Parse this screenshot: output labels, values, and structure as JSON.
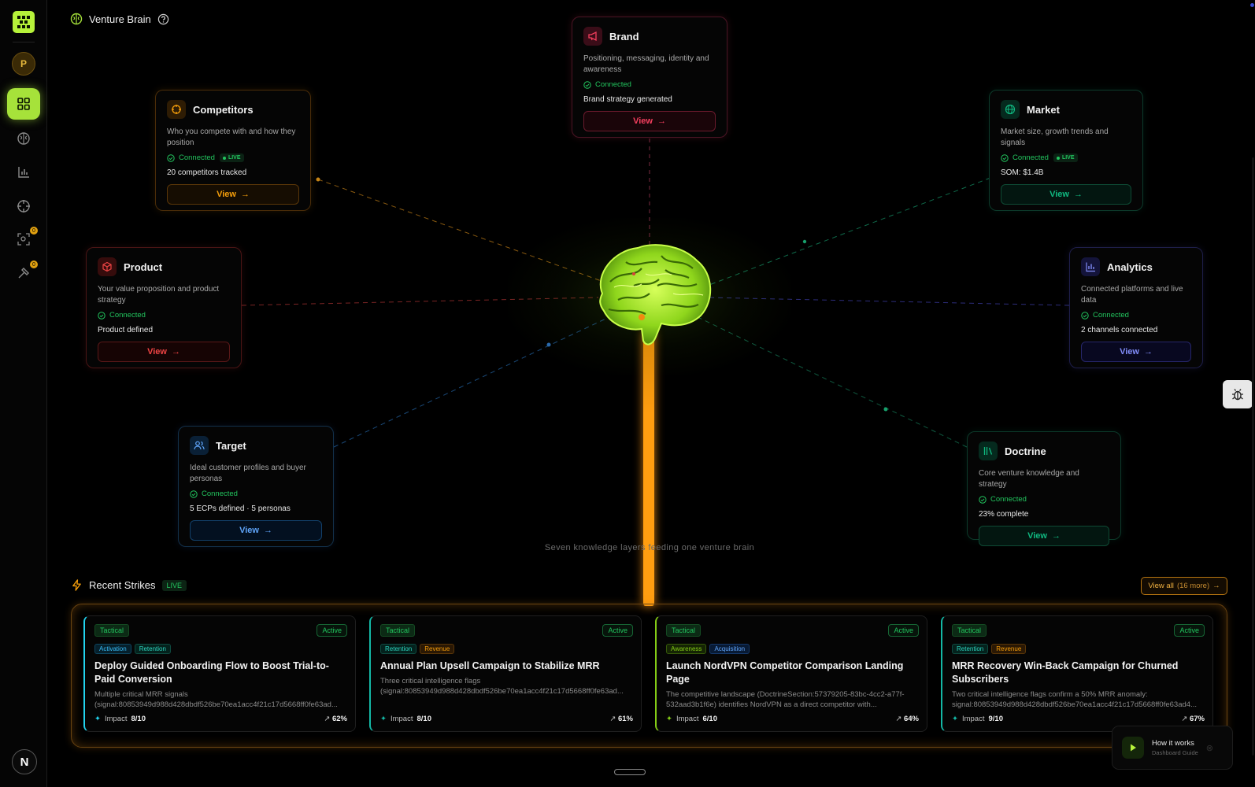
{
  "header": {
    "title": "Venture Brain"
  },
  "sidebar": {
    "avatar_initial": "P",
    "user_initial": "N",
    "badge_1": "0",
    "badge_2": "0"
  },
  "cards": {
    "brand": {
      "title": "Brand",
      "desc": "Positioning, messaging, identity and awareness",
      "status": "Connected",
      "metric": "Brand strategy generated",
      "view": "View"
    },
    "competitors": {
      "title": "Competitors",
      "desc": "Who you compete with and how they position",
      "status": "Connected",
      "live": "LIVE",
      "metric": "20 competitors tracked",
      "view": "View"
    },
    "market": {
      "title": "Market",
      "desc": "Market size, growth trends and signals",
      "status": "Connected",
      "live": "LIVE",
      "metric": "SOM: $1.4B",
      "view": "View"
    },
    "product": {
      "title": "Product",
      "desc": "Your value proposition and product strategy",
      "status": "Connected",
      "metric": "Product defined",
      "view": "View"
    },
    "analytics": {
      "title": "Analytics",
      "desc": "Connected platforms and live data",
      "status": "Connected",
      "metric": "2 channels connected",
      "view": "View"
    },
    "target": {
      "title": "Target",
      "desc": "Ideal customer profiles and buyer personas",
      "status": "Connected",
      "metric": "5 ECPs defined · 5 personas",
      "view": "View"
    },
    "doctrine": {
      "title": "Doctrine",
      "desc": "Core venture knowledge and strategy",
      "status": "Connected",
      "metric": "23% complete",
      "view": "View"
    }
  },
  "tagline": "Seven knowledge layers feeding one venture brain",
  "strikes": {
    "title": "Recent Strikes",
    "live": "LIVE",
    "view_all": "View all",
    "view_all_count": "(16 more)",
    "items": [
      {
        "type": "Tactical",
        "state": "Active",
        "tags": [
          "Activation",
          "Retention"
        ],
        "title": "Deploy Guided Onboarding Flow to Boost Trial-to-Paid Conversion",
        "desc": "Multiple critical MRR signals (signal:80853949d988d428dbdf526be70ea1acc4f21c17d5668ff0fe63ad...",
        "impact_label": "Impact",
        "impact": "8/10",
        "pct": "62%"
      },
      {
        "type": "Tactical",
        "state": "Active",
        "tags": [
          "Retention",
          "Revenue"
        ],
        "title": "Annual Plan Upsell Campaign to Stabilize MRR",
        "desc": "Three critical intelligence flags (signal:80853949d988d428dbdf526be70ea1acc4f21c17d5668ff0fe63ad...",
        "impact_label": "Impact",
        "impact": "8/10",
        "pct": "61%"
      },
      {
        "type": "Tactical",
        "state": "Active",
        "tags": [
          "Awareness",
          "Acquisition"
        ],
        "title": "Launch NordVPN Competitor Comparison Landing Page",
        "desc": "The competitive landscape (DoctrineSection:57379205-83bc-4cc2-a77f-532aad3b1f6e) identifies NordVPN as a direct competitor with...",
        "impact_label": "Impact",
        "impact": "6/10",
        "pct": "64%"
      },
      {
        "type": "Tactical",
        "state": "Active",
        "tags": [
          "Retention",
          "Revenue"
        ],
        "title": "MRR Recovery Win-Back Campaign for Churned Subscribers",
        "desc": "Two critical intelligence flags confirm a 50% MRR anomaly: signal:80853949d988d428dbdf526be70ea1acc4f21c17d5668ff0fe63ad4...",
        "impact_label": "Impact",
        "impact": "9/10",
        "pct": "67%"
      }
    ]
  },
  "how_it_works": {
    "title": "How it works",
    "subtitle": "Dashboard Guide"
  },
  "colors": {
    "accent": "#a6e23a",
    "connected": "#22c55e",
    "brand": "#f43f5e",
    "competitors": "#f59e0b",
    "market": "#10b981",
    "product": "#ef4444",
    "analytics": "#6366f1",
    "target": "#3b82f6",
    "doctrine": "#10b981",
    "beam": "#ff9d10"
  }
}
